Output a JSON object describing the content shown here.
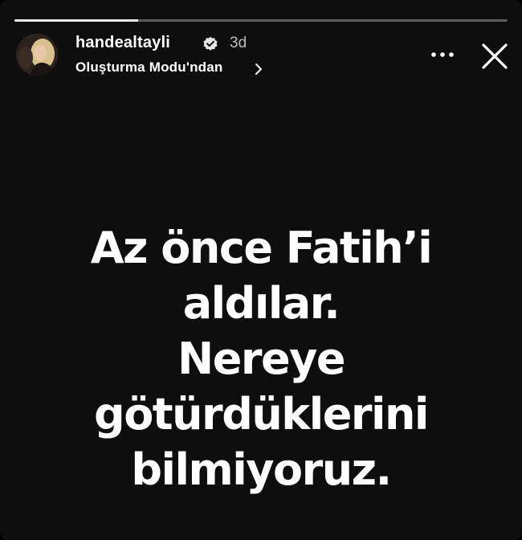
{
  "story": {
    "progress": 0.25,
    "username": "handealtayli",
    "verified_icon": "verified-badge-icon",
    "time": "3d",
    "subtitle": "Oluşturma Modu'ndan",
    "chevron_icon": "chevron-right-icon",
    "more_icon": "more-options-icon",
    "close_icon": "close-icon",
    "message_lines": [
      "Az önce Fatih’i",
      "aldılar.",
      "Nereye",
      "götürdüklerini",
      "bilmiyoruz."
    ]
  },
  "colors": {
    "background": "#0e0e0e",
    "text": "#ffffff",
    "time_text": "#bdbdbd"
  }
}
